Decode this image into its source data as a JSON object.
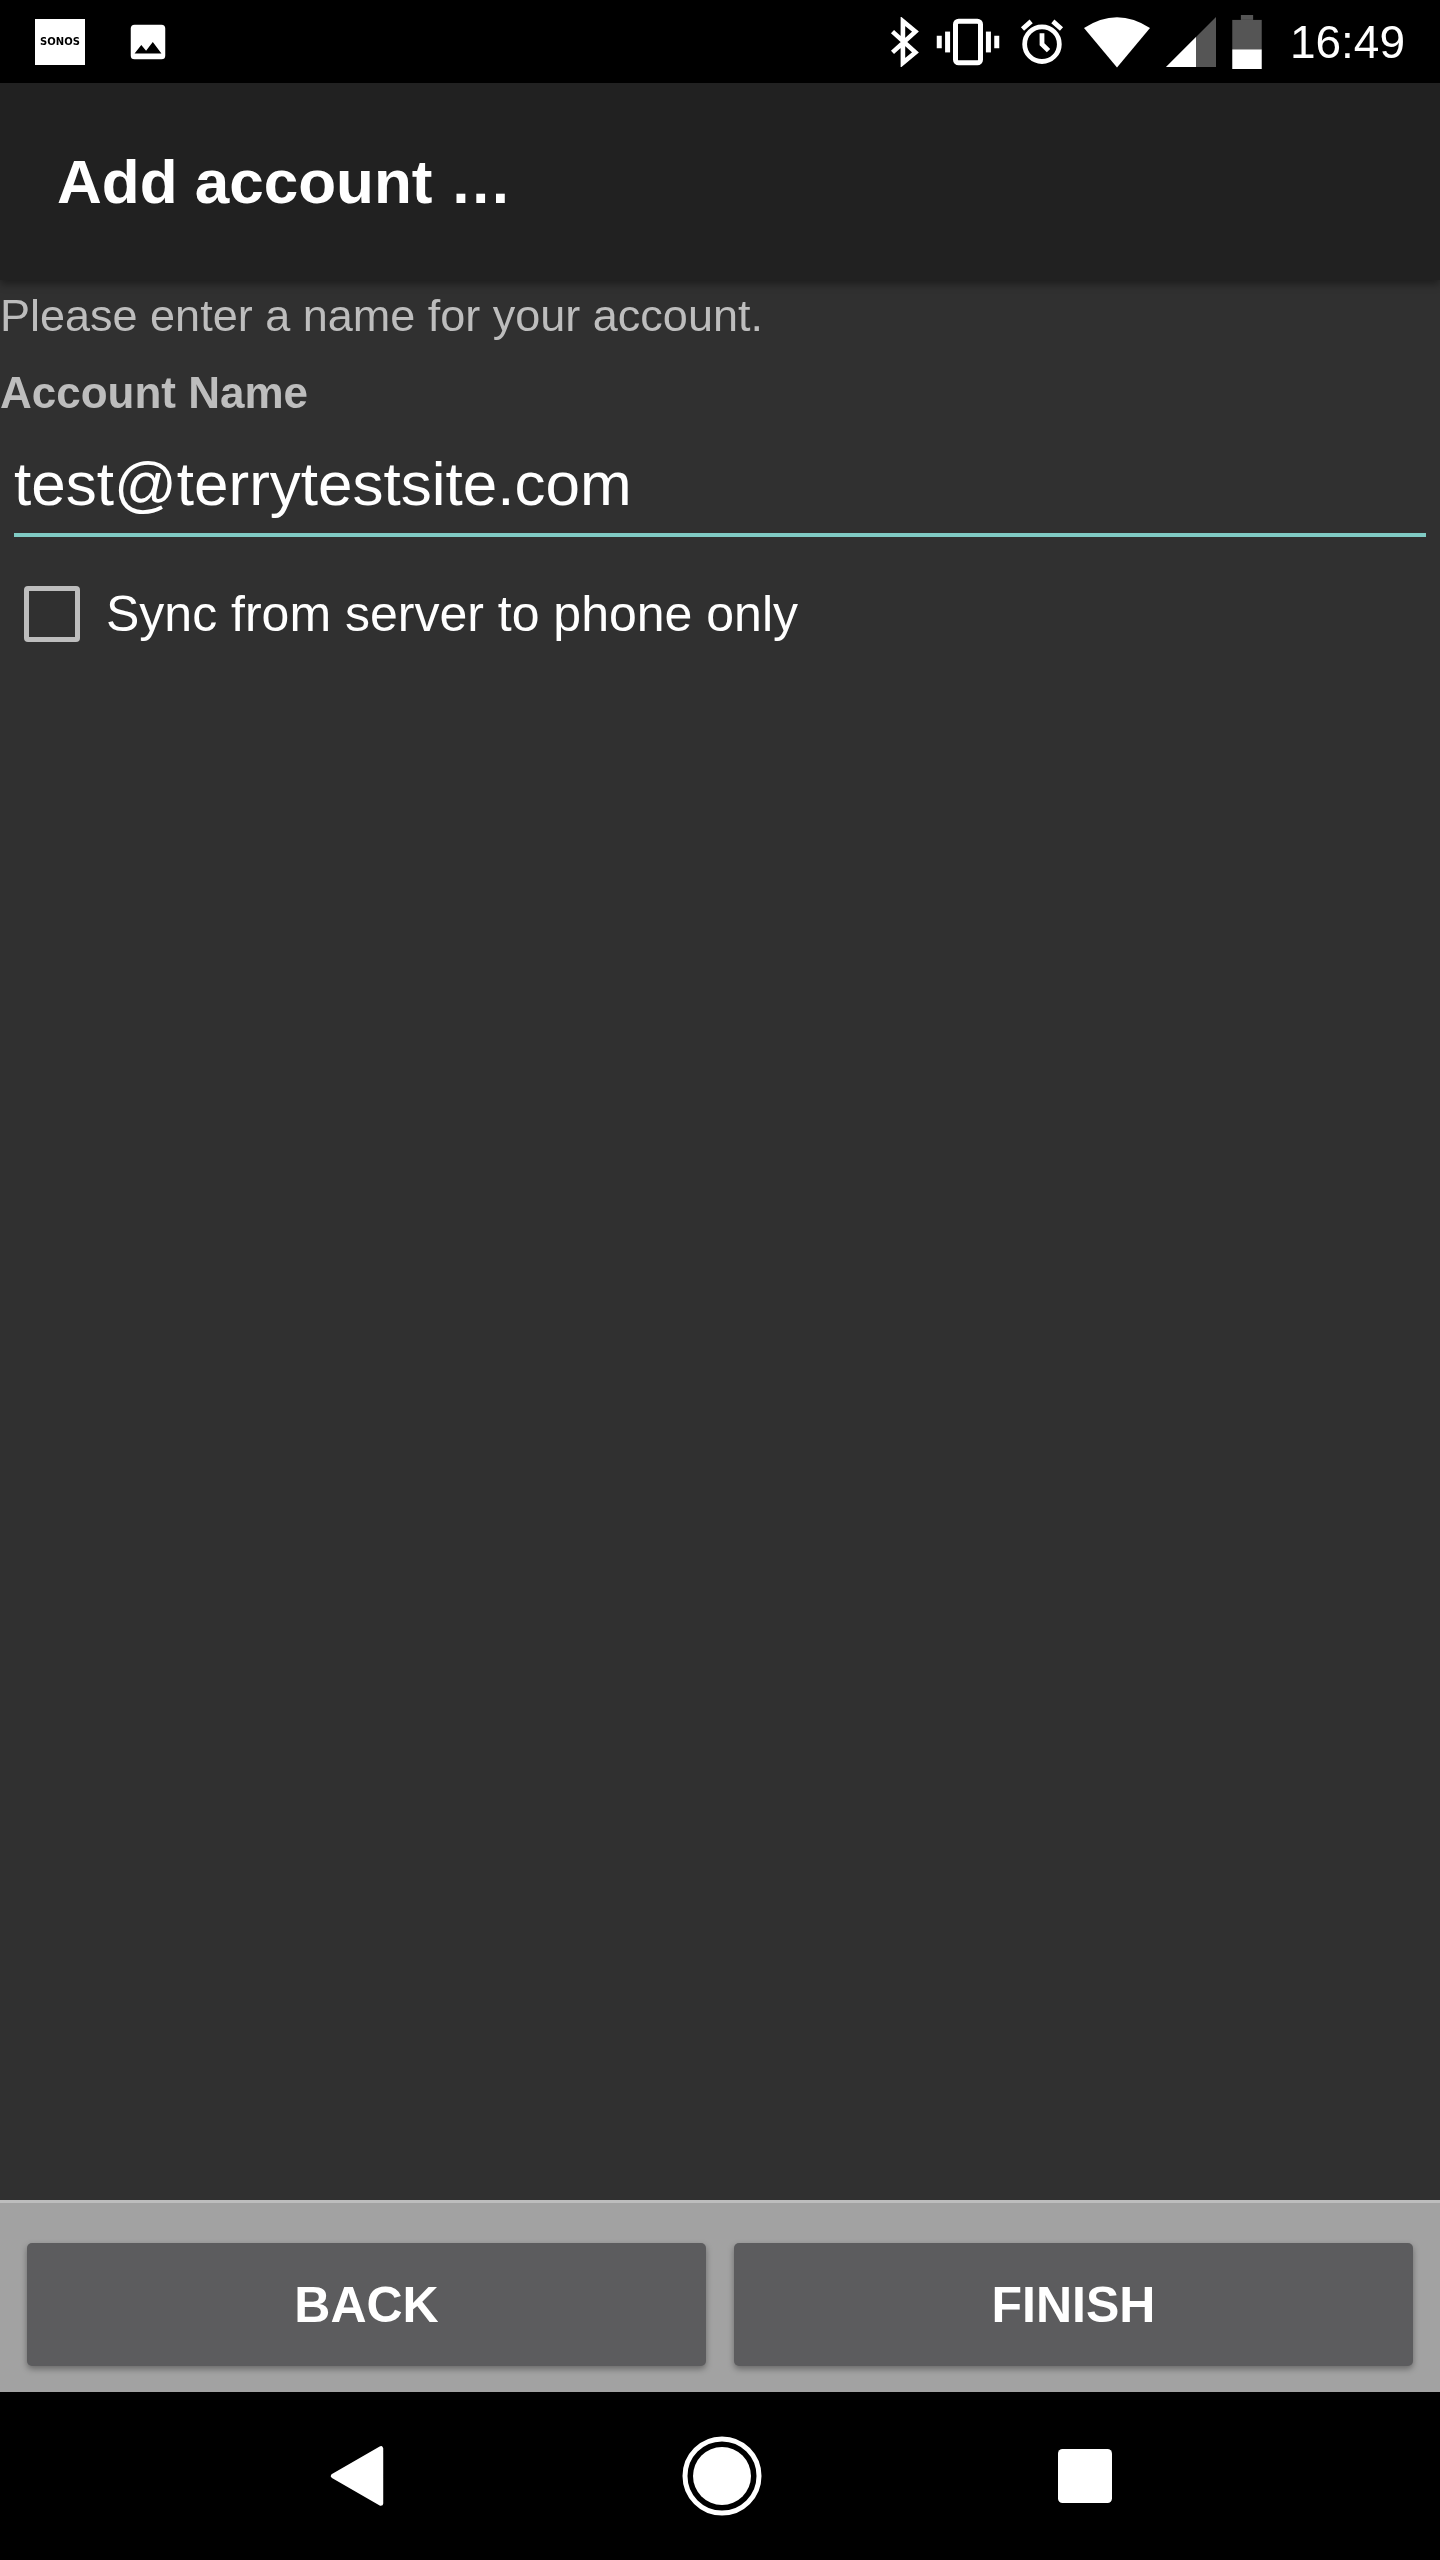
{
  "status_bar": {
    "notification_logo": "SONOS",
    "time": "16:49"
  },
  "app_bar": {
    "title": "Add account …"
  },
  "form": {
    "instruction": "Please enter a name for your account.",
    "field_label": "Account Name",
    "account_name": {
      "value": "test@terrytestsite.com",
      "focused": true
    },
    "sync_option": {
      "label": "Sync from server to phone only",
      "checked": false
    }
  },
  "buttons": [
    "BACK",
    "FINISH"
  ]
}
